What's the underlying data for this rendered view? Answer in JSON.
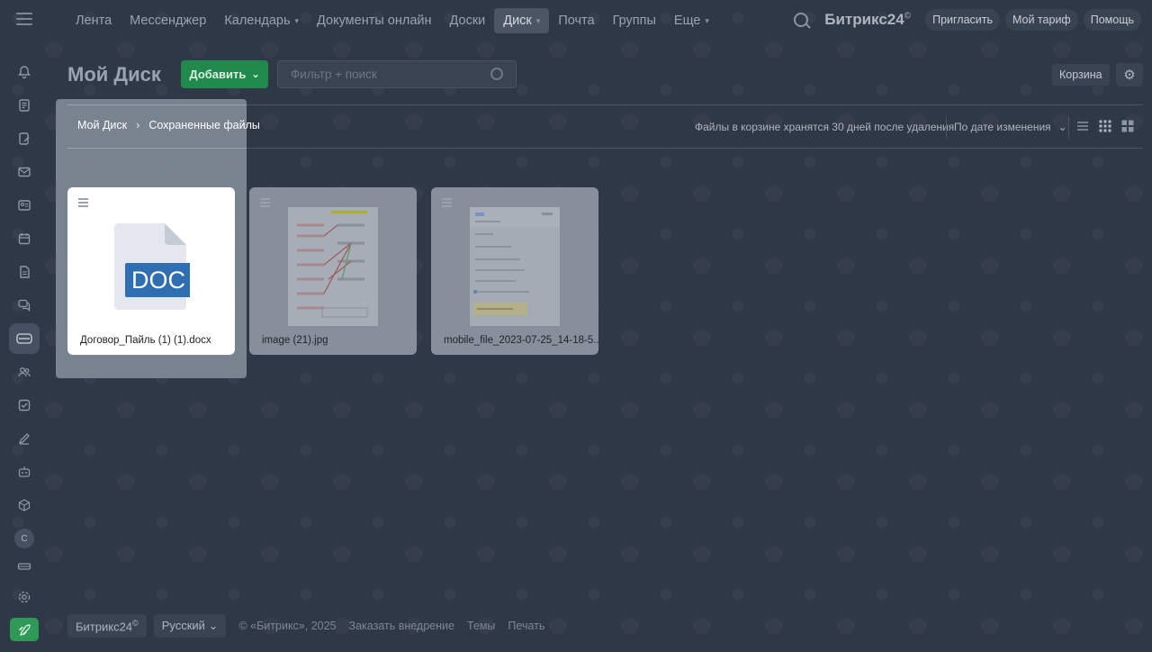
{
  "topbar": {
    "nav": [
      {
        "label": "Лента",
        "dropdown": false,
        "active": false
      },
      {
        "label": "Мессенджер",
        "dropdown": false,
        "active": false
      },
      {
        "label": "Календарь",
        "dropdown": true,
        "active": false
      },
      {
        "label": "Документы онлайн",
        "dropdown": false,
        "active": false
      },
      {
        "label": "Доски",
        "dropdown": false,
        "active": false
      },
      {
        "label": "Диск",
        "dropdown": true,
        "active": true
      },
      {
        "label": "Почта",
        "dropdown": false,
        "active": false
      },
      {
        "label": "Группы",
        "dropdown": false,
        "active": false
      },
      {
        "label": "Еще",
        "dropdown": true,
        "active": false
      }
    ],
    "brand": "Битрикс24",
    "brand_mark": "©",
    "invite_label": "Пригласить",
    "tariff_label": "Мой тариф",
    "help_label": "Помощь"
  },
  "sidebar": {
    "icons": [
      "bell-icon",
      "feed-icon",
      "tasks-edit-icon",
      "mail-icon",
      "contacts-icon",
      "calendar-icon",
      "document-icon",
      "chat-icon",
      "disk-icon",
      "users-icon",
      "checkbox-icon",
      "pen-icon",
      "robot-icon",
      "box-icon",
      "avatar-icon",
      "card-icon",
      "settings-icon",
      "rocket-icon"
    ],
    "avatar_letter": "C",
    "active": "disk-icon"
  },
  "header": {
    "title": "Мой Диск",
    "add_label": "Добавить",
    "filter_placeholder": "Фильтр + поиск",
    "trash_label": "Корзина"
  },
  "toolbar": {
    "breadcrumbs": [
      "Мой Диск",
      "Сохраненные файлы"
    ],
    "trash_note": "Файлы в корзине хранятся 30 дней после удаления",
    "sort_label": "По дате изменения"
  },
  "files": [
    {
      "name": "Договор_Пайль (1) (1).docx",
      "type": "DOC"
    },
    {
      "name": "image (21).jpg",
      "type": "image"
    },
    {
      "name": "mobile_file_2023-07-25_14-18-5...",
      "type": "image"
    }
  ],
  "footer": {
    "brand": "Битрикс24",
    "brand_mark": "©",
    "language": "Русский",
    "copyright": "© «Битрикс», 2025",
    "order_link": "Заказать внедрение",
    "themes_link": "Темы",
    "print_link": "Печать"
  },
  "colors": {
    "background": "#2f3846",
    "accent_green": "#1f8a4c",
    "doc_blue": "#2f6fb1"
  }
}
